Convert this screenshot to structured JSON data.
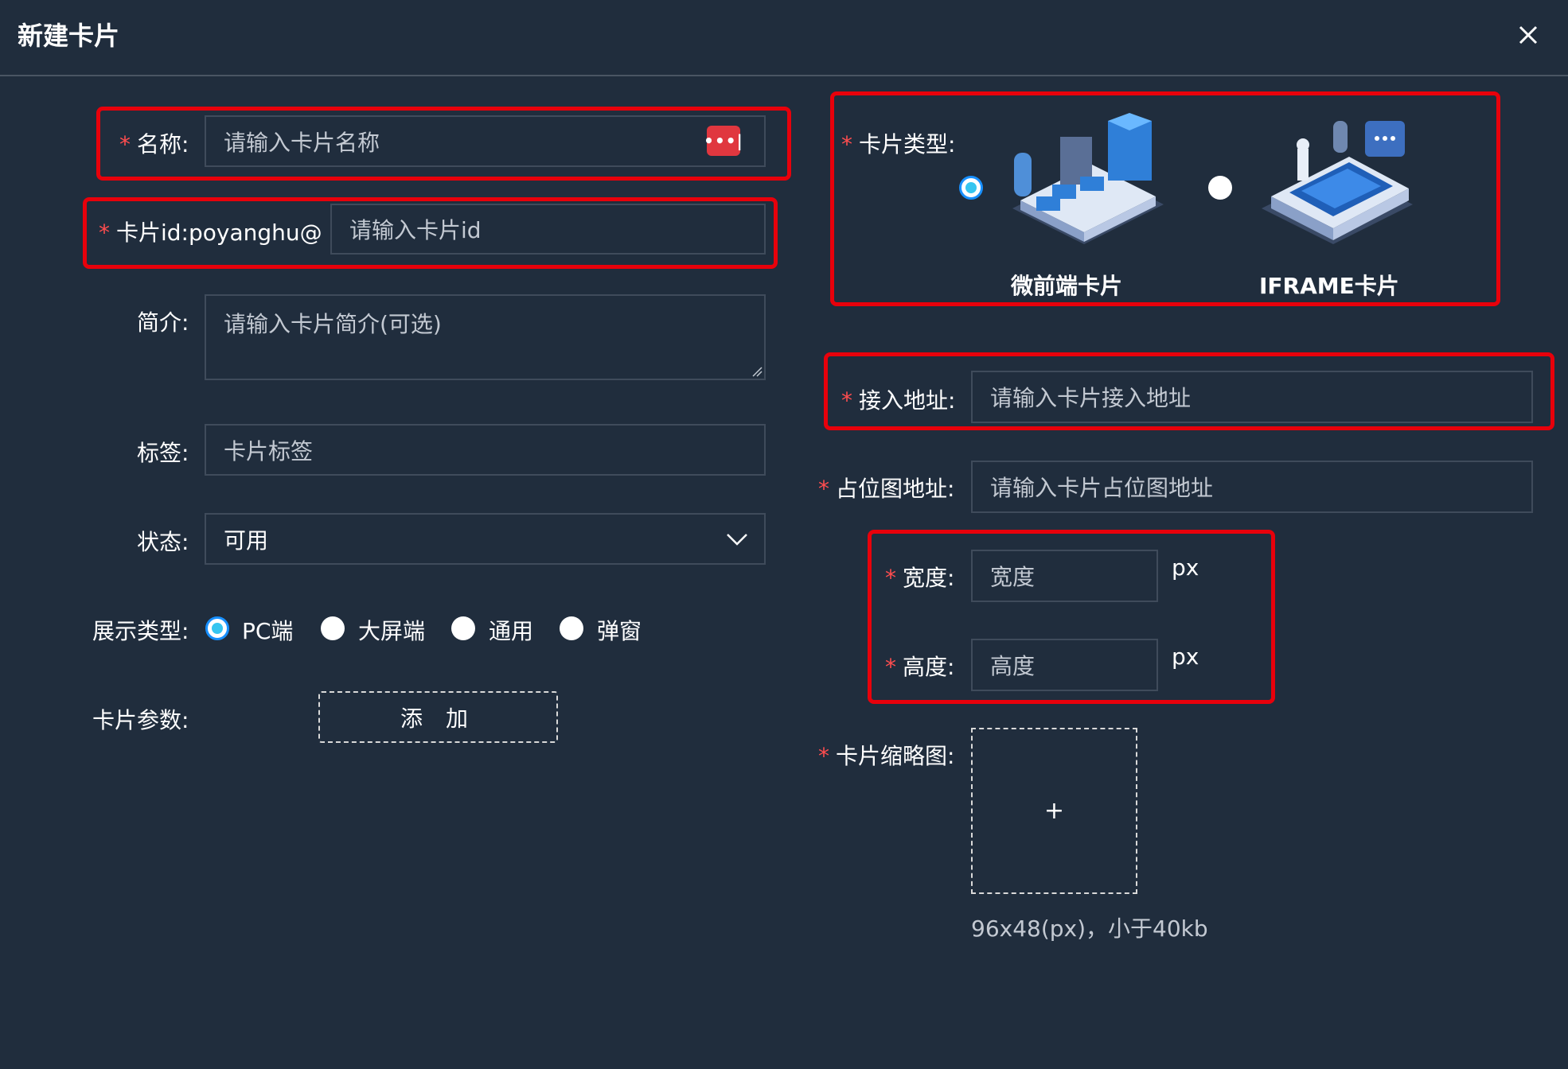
{
  "dialog": {
    "title": "新建卡片",
    "close_icon": "close-icon"
  },
  "colors": {
    "background": "#202d3d",
    "required": "#ff4d4f",
    "highlight": "#e8000b",
    "radio_selected": "#36c5f0"
  },
  "form": {
    "required_mark": "*",
    "name": {
      "label": "名称:",
      "placeholder": "请输入卡片名称",
      "icon": "password-manager-icon"
    },
    "card_id": {
      "label": "卡片id:",
      "prefix": "poyanghu@",
      "placeholder": "请输入卡片id"
    },
    "intro": {
      "label": "简介:",
      "placeholder": "请输入卡片简介(可选)"
    },
    "tags": {
      "label": "标签:",
      "placeholder": "卡片标签"
    },
    "status": {
      "label": "状态:",
      "value": "可用"
    },
    "display_type": {
      "label": "展示类型:",
      "options": [
        "PC端",
        "大屏端",
        "通用",
        "弹窗"
      ],
      "selected": "PC端"
    },
    "params": {
      "label": "卡片参数:",
      "add_label": "添 加"
    },
    "card_type": {
      "label": "卡片类型:",
      "options": [
        "微前端卡片",
        "IFRAME卡片"
      ],
      "selected": "微前端卡片"
    },
    "access_url": {
      "label": "接入地址:",
      "placeholder": "请输入卡片接入地址"
    },
    "placeholder_url": {
      "label": "占位图地址:",
      "placeholder": "请输入卡片占位图地址"
    },
    "width": {
      "label": "宽度:",
      "placeholder": "宽度",
      "unit": "px"
    },
    "height": {
      "label": "高度:",
      "placeholder": "高度",
      "unit": "px"
    },
    "thumbnail": {
      "label": "卡片缩略图:",
      "plus": "+",
      "hint": "96x48(px)，小于40kb"
    }
  }
}
